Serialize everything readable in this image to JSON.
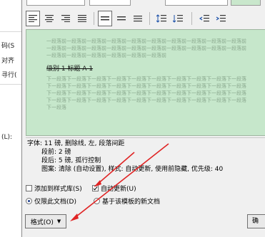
{
  "background_window": {
    "labels": [
      "码(S",
      "对齐",
      "寻行(",
      "(L):"
    ]
  },
  "preview": {
    "sample_text": "级别 1 标题 A 1",
    "gray_lines": [
      "一段落前一段落前一段落前一段落前一段落前一段落前一段落前一段落前一段落前一段落前",
      "一段落前一段落前一段落前一段落前一段落前一段落前一段落前一段落前一段落前一段落前",
      "一段落前一段落前一段落前一段落前一段落前一段落前",
      "下一段落下一段落下一段落下一段落下一段落下一段落下一段落下一段落下一段落下一段落",
      "下一段落下一段落下一段落下一段落下一段落下一段落下一段落下一段落下一段落下一段落",
      "下一段落下一段落下一段落下一段落下一段落下一段落下一段落下一段落下一段落下一段落",
      "下一段落下一段落下一段落下一段落下一段落下一段落下一段落下一段落下一段落下一段落",
      "下一段落"
    ]
  },
  "description": {
    "line1": "字体: 11 磅, 删除线, 左, 段落间距",
    "line2": "段前: 2 磅",
    "line3": "段后: 5 磅, 孤行控制",
    "line4": "图案: 清除 (自动设置), 样式: 自动更新, 使用前隐藏, 优先级: 40"
  },
  "options": {
    "add_to_gallery_label": "添加到样式库(S)",
    "add_to_gallery_checked": false,
    "auto_update_label": "自动更新(U)",
    "auto_update_checked": true,
    "only_this_doc_label": "仅限此文档(D)",
    "only_this_doc_selected": true,
    "new_docs_label": "基于该模板的新文档",
    "new_docs_selected": false
  },
  "buttons": {
    "format_label": "格式(O)",
    "right_button_label": "确"
  },
  "colors": {
    "preview_bg": "#c6e7cb",
    "arrow": "#e02424"
  },
  "icons": [
    "align-left-icon",
    "align-center-icon",
    "align-right-icon",
    "justify-icon",
    "align-left-selected-icon",
    "align-center-icon",
    "align-right-icon",
    "line-spacing-increase-icon",
    "line-spacing-decrease-icon",
    "indent-decrease-icon",
    "indent-increase-icon"
  ]
}
